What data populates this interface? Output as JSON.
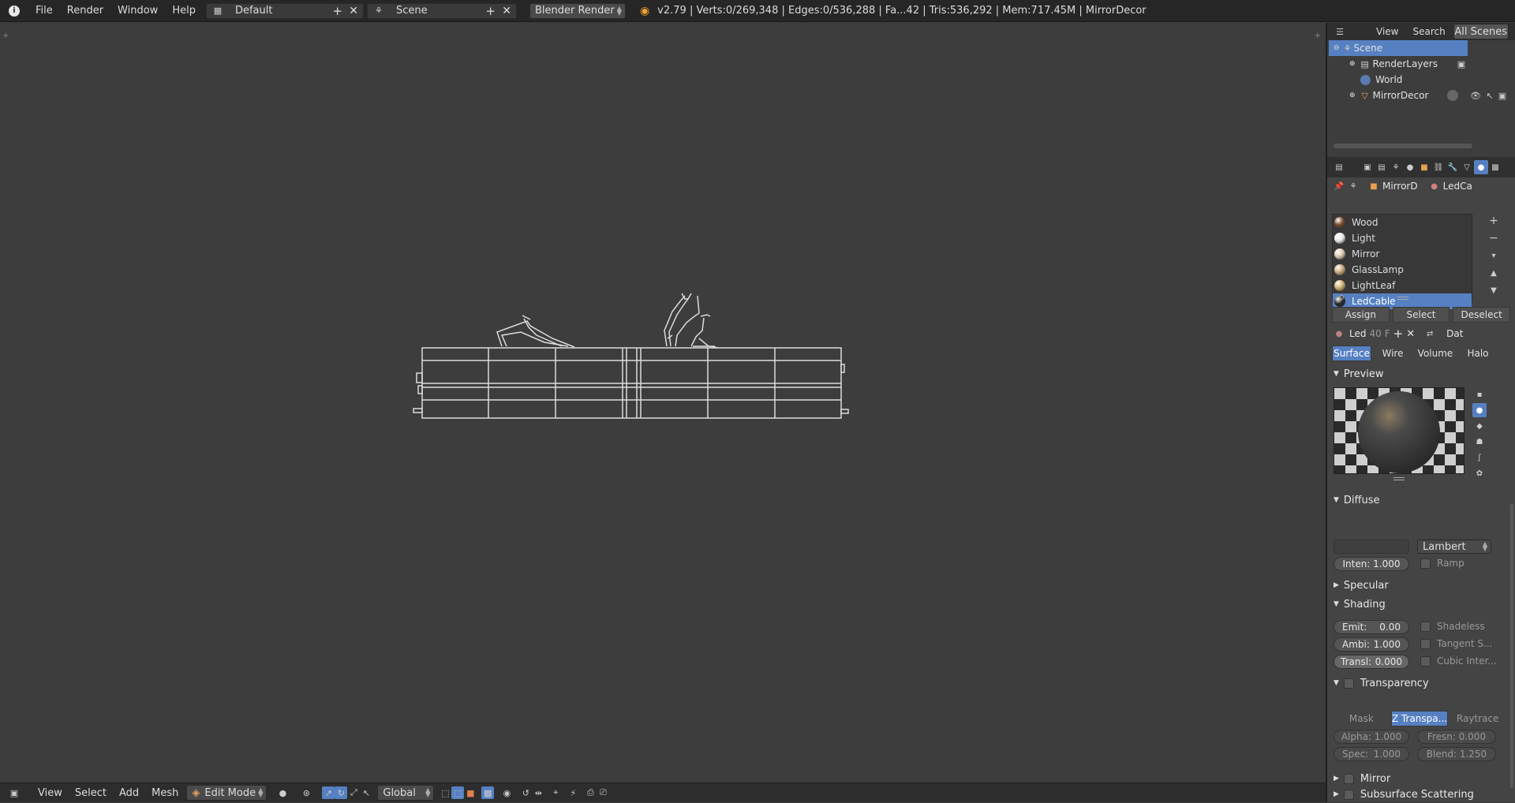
{
  "topbar": {
    "menus": [
      "File",
      "Render",
      "Window",
      "Help"
    ],
    "layout": "Default",
    "scene": "Scene",
    "engine": "Blender Render",
    "stats": "v2.79 | Verts:0/269,348 | Edges:0/536,288 | Fa...42 | Tris:536,292 | Mem:717.45M | MirrorDecor"
  },
  "outliner": {
    "tabs": [
      "View",
      "Search",
      "All Scenes"
    ],
    "items": [
      "Scene",
      "RenderLayers",
      "World",
      "MirrorDecor"
    ]
  },
  "props": {
    "breadcrumb": [
      "MirrorD",
      "LedCa"
    ],
    "materials": [
      {
        "name": "Wood",
        "color": "#7a4a2a"
      },
      {
        "name": "Light",
        "color": "#e8e8e8"
      },
      {
        "name": "Mirror",
        "color": "#d8c8a8"
      },
      {
        "name": "GlassLamp",
        "color": "#c8a878"
      },
      {
        "name": "LightLeaf",
        "color": "#d0b070"
      },
      {
        "name": "LedCable",
        "color": "#2a2a2a"
      }
    ],
    "slot_actions": [
      "Assign",
      "Select",
      "Deselect"
    ],
    "datablock": {
      "name": "Led",
      "users": "40",
      "fake": "F",
      "link": "Dat"
    },
    "type_tabs": [
      "Surface",
      "Wire",
      "Volume",
      "Halo"
    ],
    "preview_title": "Preview",
    "diffuse": {
      "title": "Diffuse",
      "shader": "Lambert",
      "intensity": "Inten: 1.000",
      "ramp": "Ramp"
    },
    "specular_title": "Specular",
    "shading": {
      "title": "Shading",
      "emit": "Emit:",
      "emit_val": "0.00",
      "ambi": "Ambi:",
      "ambi_val": "1.000",
      "transl": "Transl:",
      "transl_val": "0.000",
      "shadeless": "Shadeless",
      "tangent": "Tangent S...",
      "cubic": "Cubic Inter..."
    },
    "transparency": {
      "title": "Transparency",
      "modes": [
        "Mask",
        "Z Transpa...",
        "Raytrace"
      ],
      "alpha": "Alpha: 1.000",
      "fresnel": "Fresn: 0.000",
      "spec": "Spec: ",
      "spec_val": "1.000",
      "blend": "Blend: 1.250"
    },
    "mirror_title": "Mirror",
    "sss_title": "Subsurface Scattering"
  },
  "bottombar": {
    "menus": [
      "View",
      "Select",
      "Add",
      "Mesh"
    ],
    "mode": "Edit Mode",
    "orientation": "Global"
  }
}
